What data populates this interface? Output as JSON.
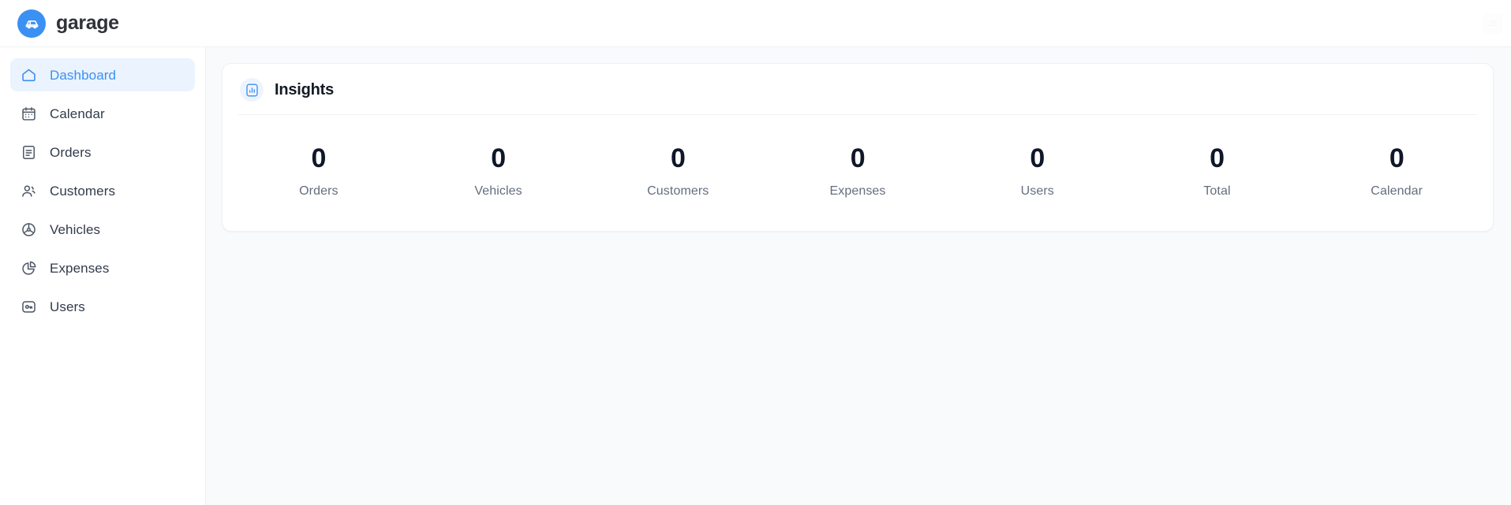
{
  "header": {
    "brand_name": "garage",
    "logo_icon": "car-icon",
    "logo_color": "#3b90f3",
    "right_action_icon": "menu-icon"
  },
  "sidebar": {
    "items": [
      {
        "label": "Dashboard",
        "icon": "home-icon",
        "active": true
      },
      {
        "label": "Calendar",
        "icon": "calendar-icon",
        "active": false
      },
      {
        "label": "Orders",
        "icon": "document-icon",
        "active": false
      },
      {
        "label": "Customers",
        "icon": "users-icon",
        "active": false
      },
      {
        "label": "Vehicles",
        "icon": "steering-wheel-icon",
        "active": false
      },
      {
        "label": "Expenses",
        "icon": "pie-chart-icon",
        "active": false
      },
      {
        "label": "Users",
        "icon": "key-badge-icon",
        "active": false
      }
    ],
    "active_text_color": "#3b90f3",
    "active_bg_color": "#eaf3fe"
  },
  "main": {
    "card": {
      "title": "Insights",
      "icon": "bar-chart-icon",
      "icon_color": "#3b90f3"
    },
    "stats": [
      {
        "label": "Orders",
        "value": "0"
      },
      {
        "label": "Vehicles",
        "value": "0"
      },
      {
        "label": "Customers",
        "value": "0"
      },
      {
        "label": "Expenses",
        "value": "0"
      },
      {
        "label": "Users",
        "value": "0"
      },
      {
        "label": "Total",
        "value": "0"
      },
      {
        "label": "Calendar",
        "value": "0"
      }
    ]
  },
  "theme": {
    "page_bg": "#f8fafc",
    "card_bg": "#ffffff",
    "border": "#eef1f5",
    "text_primary": "#111827",
    "text_muted": "#646e7e",
    "accent": "#3b90f3"
  }
}
